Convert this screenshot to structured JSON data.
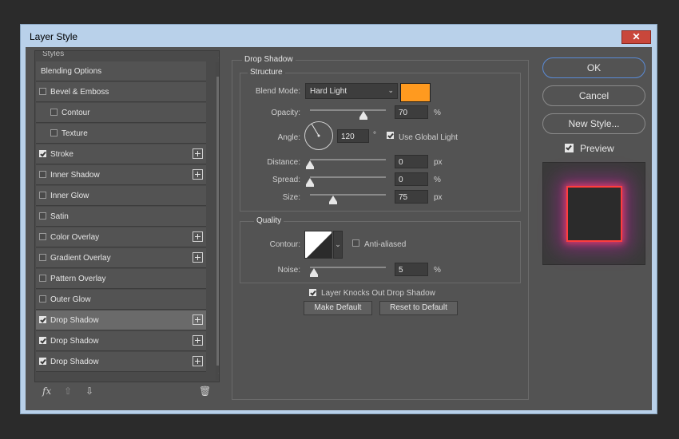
{
  "window": {
    "title": "Layer Style",
    "close_glyph": "✕"
  },
  "styles_list": {
    "header": "Styles",
    "items": [
      {
        "label": "Blending Options",
        "checkbox": false,
        "checked": false,
        "plus": false,
        "selected": false
      },
      {
        "label": "Bevel & Emboss",
        "checkbox": true,
        "checked": false,
        "plus": false,
        "selected": false
      },
      {
        "label": "Contour",
        "checkbox": true,
        "checked": false,
        "plus": false,
        "selected": false,
        "indent": true
      },
      {
        "label": "Texture",
        "checkbox": true,
        "checked": false,
        "plus": false,
        "selected": false,
        "indent": true
      },
      {
        "label": "Stroke",
        "checkbox": true,
        "checked": true,
        "plus": true,
        "selected": false
      },
      {
        "label": "Inner Shadow",
        "checkbox": true,
        "checked": false,
        "plus": true,
        "selected": false
      },
      {
        "label": "Inner Glow",
        "checkbox": true,
        "checked": false,
        "plus": false,
        "selected": false
      },
      {
        "label": "Satin",
        "checkbox": true,
        "checked": false,
        "plus": false,
        "selected": false
      },
      {
        "label": "Color Overlay",
        "checkbox": true,
        "checked": false,
        "plus": true,
        "selected": false
      },
      {
        "label": "Gradient Overlay",
        "checkbox": true,
        "checked": false,
        "plus": true,
        "selected": false
      },
      {
        "label": "Pattern Overlay",
        "checkbox": true,
        "checked": false,
        "plus": false,
        "selected": false
      },
      {
        "label": "Outer Glow",
        "checkbox": true,
        "checked": false,
        "plus": false,
        "selected": false
      },
      {
        "label": "Drop Shadow",
        "checkbox": true,
        "checked": true,
        "plus": true,
        "selected": true
      },
      {
        "label": "Drop Shadow",
        "checkbox": true,
        "checked": true,
        "plus": true,
        "selected": false
      },
      {
        "label": "Drop Shadow",
        "checkbox": true,
        "checked": true,
        "plus": true,
        "selected": false
      }
    ],
    "tools": {
      "fx": "fx",
      "up": "⇧",
      "down": "⇩",
      "trash": "🗑"
    }
  },
  "drop_shadow": {
    "title": "Drop Shadow",
    "structure": {
      "title": "Structure",
      "blend_mode_label": "Blend Mode:",
      "blend_mode_value": "Hard Light",
      "color": "#ff9a1f",
      "opacity_label": "Opacity:",
      "opacity_value": "70",
      "opacity_unit": "%",
      "opacity_fraction": 0.7,
      "angle_label": "Angle:",
      "angle_value": "120",
      "angle_unit": "°",
      "use_global_light_label": "Use Global Light",
      "use_global_light": true,
      "distance_label": "Distance:",
      "distance_value": "0",
      "distance_unit": "px",
      "distance_fraction": 0.0,
      "spread_label": "Spread:",
      "spread_value": "0",
      "spread_unit": "%",
      "spread_fraction": 0.0,
      "size_label": "Size:",
      "size_value": "75",
      "size_unit": "px",
      "size_fraction": 0.3
    },
    "quality": {
      "title": "Quality",
      "contour_label": "Contour:",
      "anti_aliased_label": "Anti-aliased",
      "anti_aliased": false,
      "noise_label": "Noise:",
      "noise_value": "5",
      "noise_unit": "%",
      "noise_fraction": 0.05
    },
    "knock_out_label": "Layer Knocks Out Drop Shadow",
    "knock_out": true,
    "make_default": "Make Default",
    "reset_default": "Reset to Default"
  },
  "buttons": {
    "ok": "OK",
    "cancel": "Cancel",
    "new_style": "New Style..."
  },
  "preview": {
    "label": "Preview",
    "checked": true
  },
  "colors": {
    "accent": "#5a8bd6",
    "swatch": "#ff9a1f",
    "panel": "#535353"
  }
}
